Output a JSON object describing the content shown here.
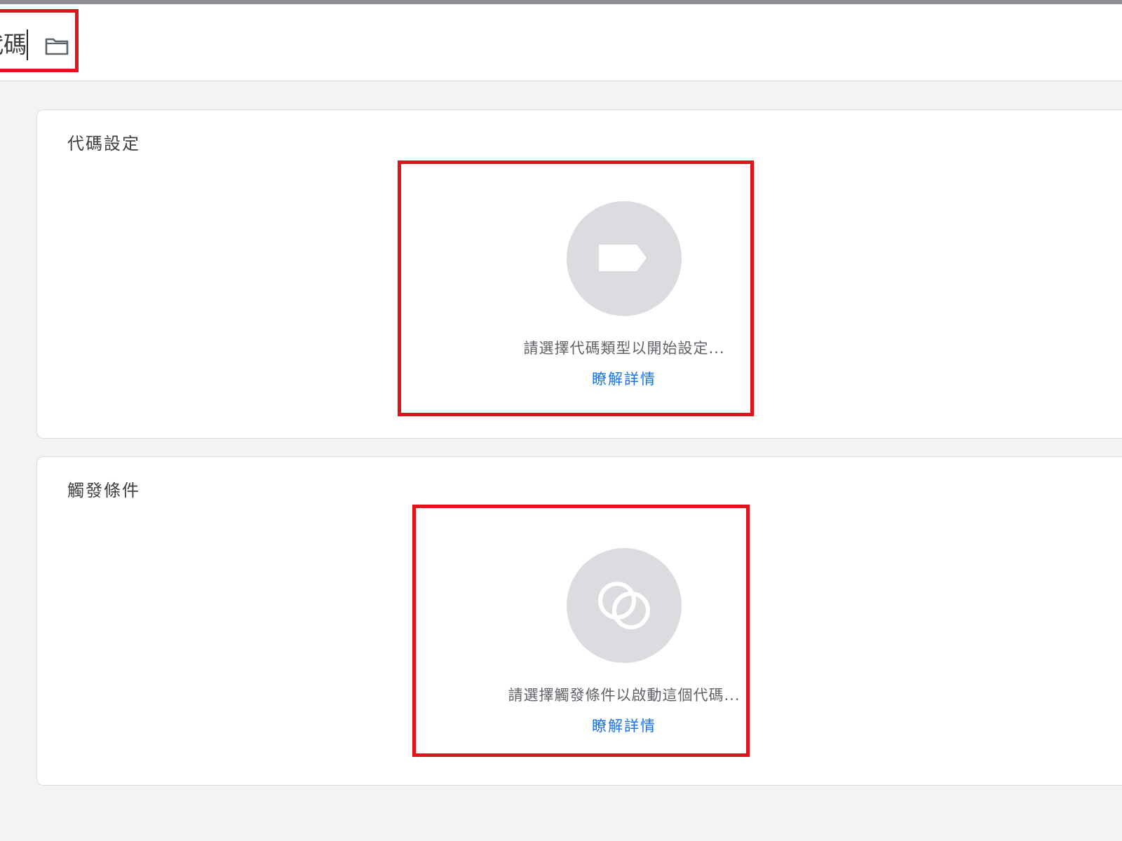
{
  "header": {
    "name_value": "代碼",
    "folder_icon": "folder-icon"
  },
  "tag_config": {
    "title": "代碼設定",
    "icon": "tag-icon",
    "prompt": "請選擇代碼類型以開始設定...",
    "learn_more": "瞭解詳情"
  },
  "triggering": {
    "title": "觸發條件",
    "icon": "trigger-circles-icon",
    "prompt": "請選擇觸發條件以啟動這個代碼...",
    "learn_more": "瞭解詳情"
  },
  "colors": {
    "highlight": "#e0141c",
    "link": "#1a73e8",
    "icon_circle": "#dadce0"
  }
}
